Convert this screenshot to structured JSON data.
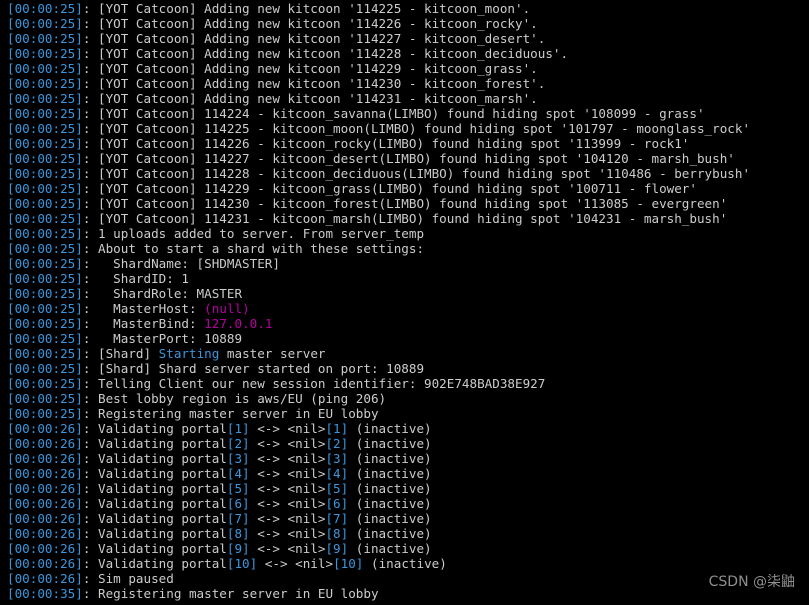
{
  "colors": {
    "background": "#000000",
    "text": "#cccccc",
    "timestamp": "#3a96dd",
    "highlight_blue": "#3a96dd",
    "highlight_magenta": "#b4009e",
    "watermark": "#a8a8a8"
  },
  "watermark": "CSDN @柒鼬",
  "lines": [
    {
      "ts": "[00:00:25]",
      "msg": ": [YOT Catcoon] Adding new kitcoon '114225 - kitcoon_moon'."
    },
    {
      "ts": "[00:00:25]",
      "msg": ": [YOT Catcoon] Adding new kitcoon '114226 - kitcoon_rocky'."
    },
    {
      "ts": "[00:00:25]",
      "msg": ": [YOT Catcoon] Adding new kitcoon '114227 - kitcoon_desert'."
    },
    {
      "ts": "[00:00:25]",
      "msg": ": [YOT Catcoon] Adding new kitcoon '114228 - kitcoon_deciduous'."
    },
    {
      "ts": "[00:00:25]",
      "msg": ": [YOT Catcoon] Adding new kitcoon '114229 - kitcoon_grass'."
    },
    {
      "ts": "[00:00:25]",
      "msg": ": [YOT Catcoon] Adding new kitcoon '114230 - kitcoon_forest'."
    },
    {
      "ts": "[00:00:25]",
      "msg": ": [YOT Catcoon] Adding new kitcoon '114231 - kitcoon_marsh'."
    },
    {
      "ts": "[00:00:25]",
      "msg": ": [YOT Catcoon] 114224 - kitcoon_savanna(LIMBO) found hiding spot '108099 - grass'"
    },
    {
      "ts": "[00:00:25]",
      "msg": ": [YOT Catcoon] 114225 - kitcoon_moon(LIMBO) found hiding spot '101797 - moonglass_rock'"
    },
    {
      "ts": "[00:00:25]",
      "msg": ": [YOT Catcoon] 114226 - kitcoon_rocky(LIMBO) found hiding spot '113999 - rock1'"
    },
    {
      "ts": "[00:00:25]",
      "msg": ": [YOT Catcoon] 114227 - kitcoon_desert(LIMBO) found hiding spot '104120 - marsh_bush'"
    },
    {
      "ts": "[00:00:25]",
      "msg": ": [YOT Catcoon] 114228 - kitcoon_deciduous(LIMBO) found hiding spot '110486 - berrybush'"
    },
    {
      "ts": "[00:00:25]",
      "msg": ": [YOT Catcoon] 114229 - kitcoon_grass(LIMBO) found hiding spot '100711 - flower'"
    },
    {
      "ts": "[00:00:25]",
      "msg": ": [YOT Catcoon] 114230 - kitcoon_forest(LIMBO) found hiding spot '113085 - evergreen'"
    },
    {
      "ts": "[00:00:25]",
      "msg": ": [YOT Catcoon] 114231 - kitcoon_marsh(LIMBO) found hiding spot '104231 - marsh_bush'"
    },
    {
      "ts": "[00:00:25]",
      "msg": ": 1 uploads added to server. From server_temp"
    },
    {
      "ts": "[00:00:25]",
      "msg": ": About to start a shard with these settings:"
    },
    {
      "ts": "[00:00:25]",
      "msg": ":   ShardName: [SHDMASTER]"
    },
    {
      "ts": "[00:00:25]",
      "msg": ":   ShardID: 1"
    },
    {
      "ts": "[00:00:25]",
      "msg": ":   ShardRole: MASTER"
    },
    {
      "ts": "[00:00:25]",
      "parts": [
        {
          "t": ":   MasterHost: "
        },
        {
          "t": "(null)",
          "c": "magenta"
        }
      ]
    },
    {
      "ts": "[00:00:25]",
      "parts": [
        {
          "t": ":   MasterBind: "
        },
        {
          "t": "127.0.0.1",
          "c": "magenta"
        }
      ]
    },
    {
      "ts": "[00:00:25]",
      "msg": ":   MasterPort: 10889"
    },
    {
      "ts": "[00:00:25]",
      "parts": [
        {
          "t": ": [Shard] "
        },
        {
          "t": "Starting",
          "c": "blue"
        },
        {
          "t": " master server"
        }
      ]
    },
    {
      "ts": "[00:00:25]",
      "msg": ": [Shard] Shard server started on port: 10889"
    },
    {
      "ts": "[00:00:25]",
      "msg": ": Telling Client our new session identifier: 902E748BAD38E927"
    },
    {
      "ts": "[00:00:25]",
      "msg": ": Best lobby region is aws/EU (ping 206)"
    },
    {
      "ts": "[00:00:25]",
      "msg": ": Registering master server in EU lobby"
    },
    {
      "ts": "[00:00:26]",
      "parts": [
        {
          "t": ": Validating portal"
        },
        {
          "t": "[1]",
          "c": "blue"
        },
        {
          "t": " <-> <nil>"
        },
        {
          "t": "[1]",
          "c": "blue"
        },
        {
          "t": " (inactive)"
        }
      ]
    },
    {
      "ts": "[00:00:26]",
      "parts": [
        {
          "t": ": Validating portal"
        },
        {
          "t": "[2]",
          "c": "blue"
        },
        {
          "t": " <-> <nil>"
        },
        {
          "t": "[2]",
          "c": "blue"
        },
        {
          "t": " (inactive)"
        }
      ]
    },
    {
      "ts": "[00:00:26]",
      "parts": [
        {
          "t": ": Validating portal"
        },
        {
          "t": "[3]",
          "c": "blue"
        },
        {
          "t": " <-> <nil>"
        },
        {
          "t": "[3]",
          "c": "blue"
        },
        {
          "t": " (inactive)"
        }
      ]
    },
    {
      "ts": "[00:00:26]",
      "parts": [
        {
          "t": ": Validating portal"
        },
        {
          "t": "[4]",
          "c": "blue"
        },
        {
          "t": " <-> <nil>"
        },
        {
          "t": "[4]",
          "c": "blue"
        },
        {
          "t": " (inactive)"
        }
      ]
    },
    {
      "ts": "[00:00:26]",
      "parts": [
        {
          "t": ": Validating portal"
        },
        {
          "t": "[5]",
          "c": "blue"
        },
        {
          "t": " <-> <nil>"
        },
        {
          "t": "[5]",
          "c": "blue"
        },
        {
          "t": " (inactive)"
        }
      ]
    },
    {
      "ts": "[00:00:26]",
      "parts": [
        {
          "t": ": Validating portal"
        },
        {
          "t": "[6]",
          "c": "blue"
        },
        {
          "t": " <-> <nil>"
        },
        {
          "t": "[6]",
          "c": "blue"
        },
        {
          "t": " (inactive)"
        }
      ]
    },
    {
      "ts": "[00:00:26]",
      "parts": [
        {
          "t": ": Validating portal"
        },
        {
          "t": "[7]",
          "c": "blue"
        },
        {
          "t": " <-> <nil>"
        },
        {
          "t": "[7]",
          "c": "blue"
        },
        {
          "t": " (inactive)"
        }
      ]
    },
    {
      "ts": "[00:00:26]",
      "parts": [
        {
          "t": ": Validating portal"
        },
        {
          "t": "[8]",
          "c": "blue"
        },
        {
          "t": " <-> <nil>"
        },
        {
          "t": "[8]",
          "c": "blue"
        },
        {
          "t": " (inactive)"
        }
      ]
    },
    {
      "ts": "[00:00:26]",
      "parts": [
        {
          "t": ": Validating portal"
        },
        {
          "t": "[9]",
          "c": "blue"
        },
        {
          "t": " <-> <nil>"
        },
        {
          "t": "[9]",
          "c": "blue"
        },
        {
          "t": " (inactive)"
        }
      ]
    },
    {
      "ts": "[00:00:26]",
      "parts": [
        {
          "t": ": Validating portal"
        },
        {
          "t": "[10]",
          "c": "blue"
        },
        {
          "t": " <-> <nil>"
        },
        {
          "t": "[10]",
          "c": "blue"
        },
        {
          "t": " (inactive)"
        }
      ]
    },
    {
      "ts": "[00:00:26]",
      "msg": ": Sim paused"
    },
    {
      "ts": "[00:00:35]",
      "msg": ": Registering master server in EU lobby"
    }
  ]
}
